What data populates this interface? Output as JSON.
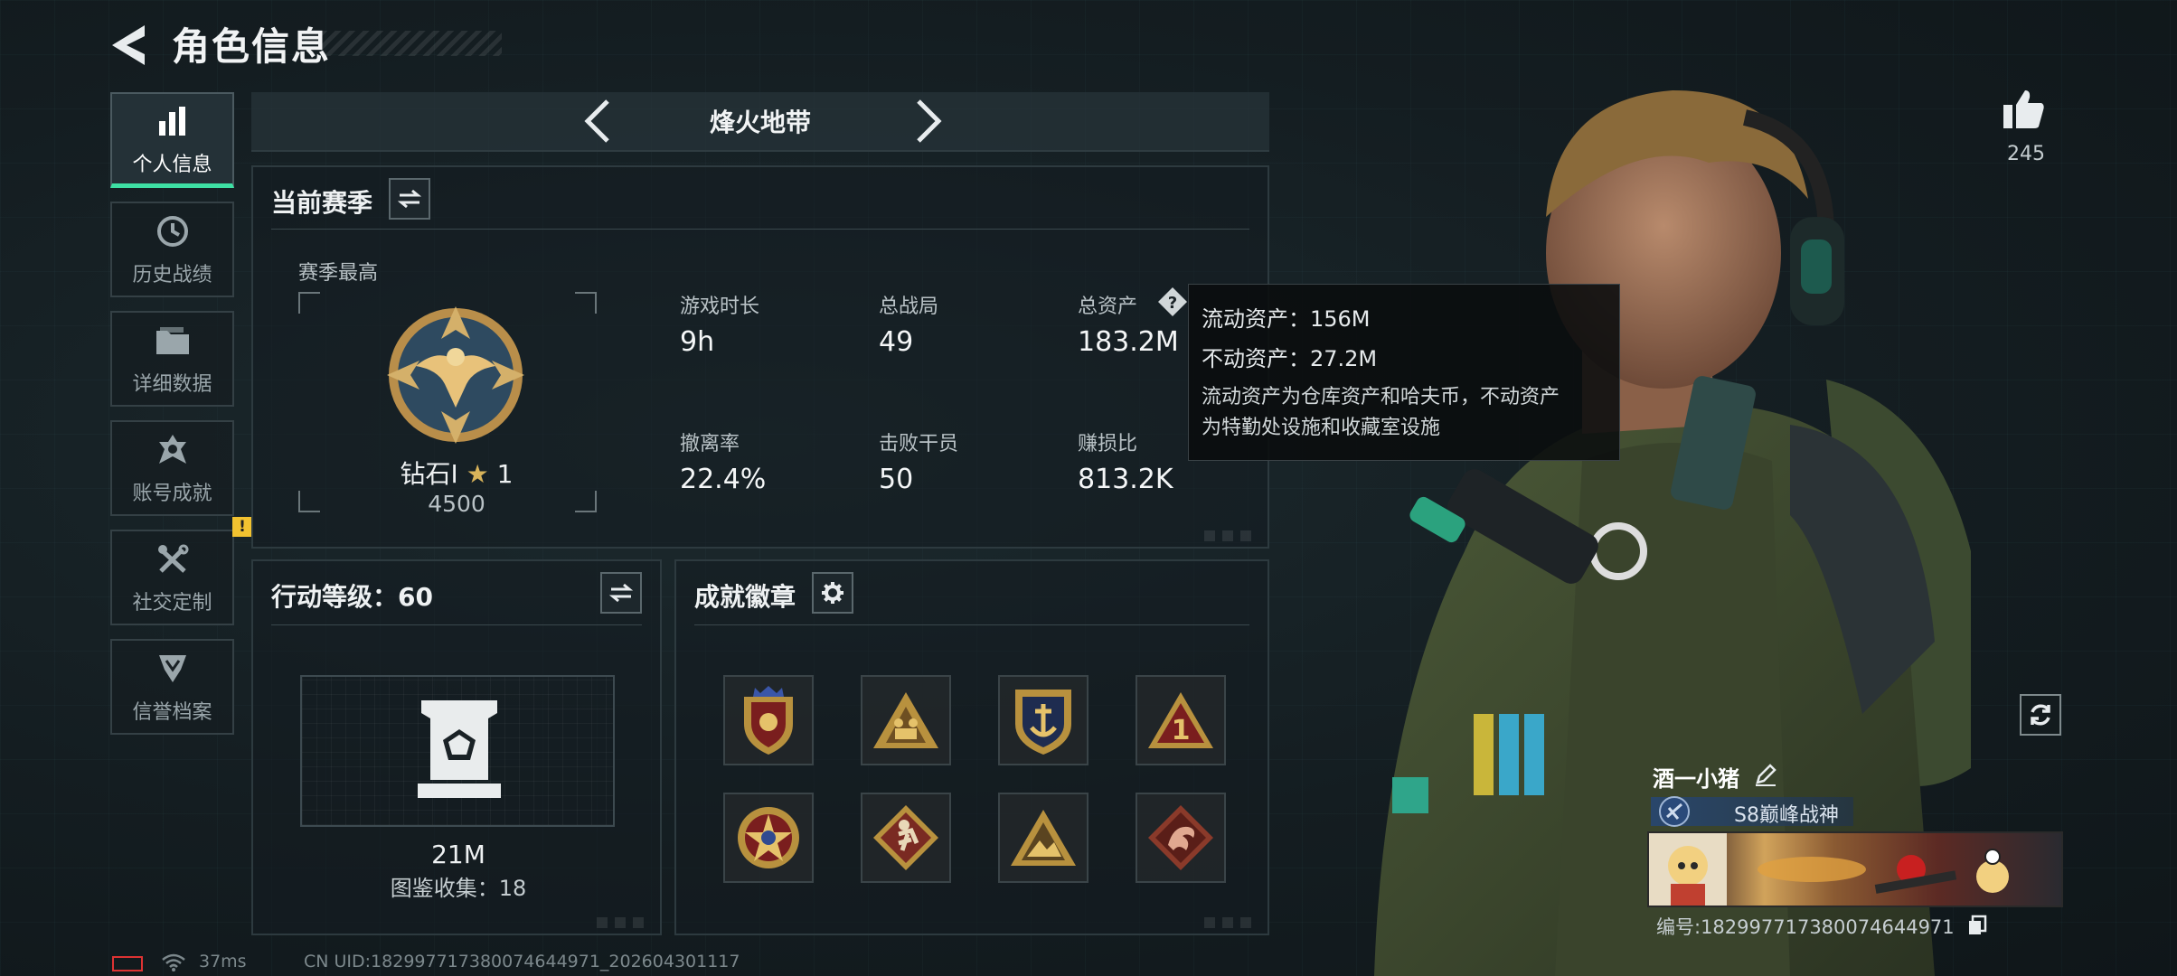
{
  "header": {
    "title": "角色信息"
  },
  "sidebar": {
    "items": [
      {
        "label": "个人信息",
        "icon": "bar-chart-icon",
        "active": true
      },
      {
        "label": "历史战绩",
        "icon": "clock-icon",
        "active": false
      },
      {
        "label": "详细数据",
        "icon": "folder-icon",
        "active": false
      },
      {
        "label": "账号成就",
        "icon": "achievement-icon",
        "active": false
      },
      {
        "label": "社交定制",
        "icon": "tools-icon",
        "active": false,
        "badge": "!"
      },
      {
        "label": "信誉档案",
        "icon": "credit-shield-icon",
        "active": false
      }
    ]
  },
  "mode_selector": {
    "title": "烽火地带"
  },
  "season_panel": {
    "title": "当前赛季",
    "best_label": "赛季最高",
    "rank_name": "钻石I",
    "rank_stars": "1",
    "rank_points": "4500",
    "stats": [
      {
        "label": "游戏时长",
        "value": "9h"
      },
      {
        "label": "总战局",
        "value": "49"
      },
      {
        "label": "总资产",
        "value": "183.2M"
      },
      {
        "label": "撤离率",
        "value": "22.4%"
      },
      {
        "label": "击败干员",
        "value": "50"
      },
      {
        "label": "赚损比",
        "value": "813.2K"
      }
    ]
  },
  "tooltip": {
    "liquid": "流动资产：156M",
    "fixed": "不动资产：27.2M",
    "desc_line1": "流动资产为仓库资产和哈夫币，不动资产",
    "desc_line2": "为特勤处设施和收藏室设施"
  },
  "action_level_panel": {
    "title": "行动等级：60",
    "value": "21M",
    "collection": "图鉴收集：18"
  },
  "badges_panel": {
    "title": "成就徽章",
    "badges": [
      "crest-badge-icon",
      "squad-badge-icon",
      "anchor-badge-icon",
      "number-one-badge-icon",
      "star-badge-icon",
      "runner-badge-icon",
      "mountain-badge-icon",
      "dragon-badge-icon"
    ]
  },
  "likes": {
    "count": "245"
  },
  "player": {
    "name": "酒一小猪",
    "rank_title": "S8巅峰战神",
    "id_text": "编号:1829977173800746449​71"
  },
  "status": {
    "ping": "37ms",
    "uid": "CN UID:182997717380074644971_202604301117"
  },
  "colors": {
    "accent": "#3ee0a4",
    "warn": "#f2c230",
    "battery": "#dd3333"
  }
}
